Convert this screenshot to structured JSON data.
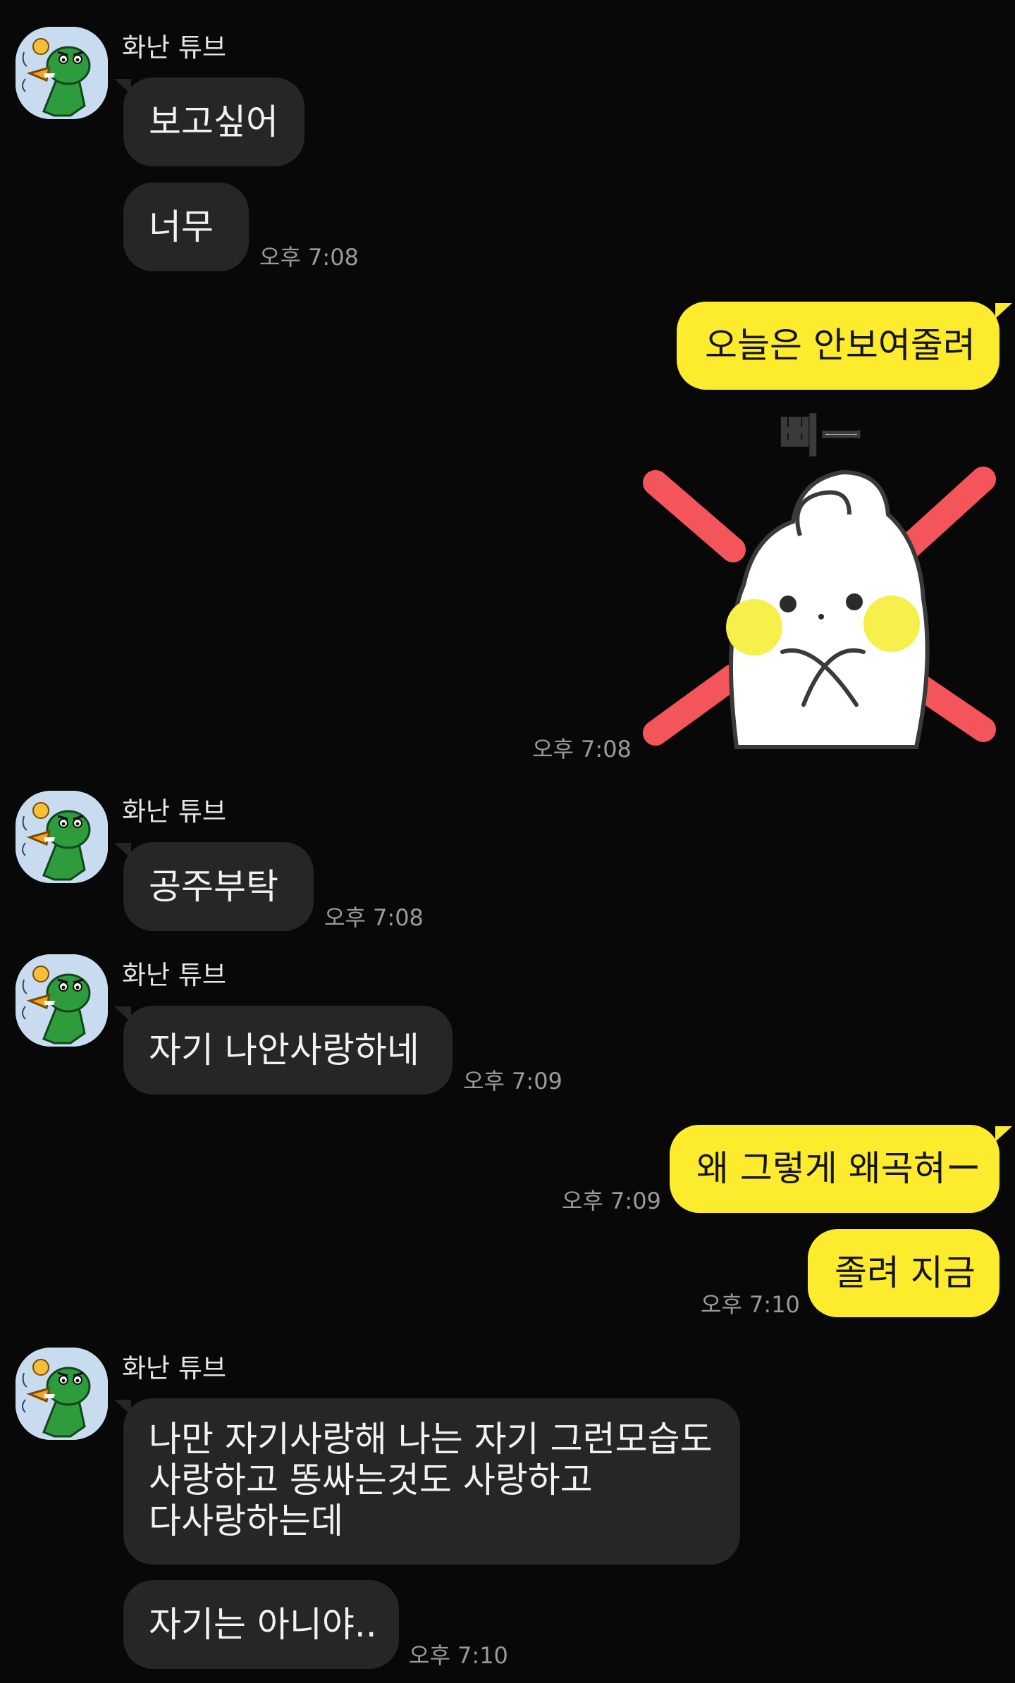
{
  "contact": {
    "name": "화난 튜브",
    "avatar_icon": "angry-tube-avatar-icon"
  },
  "colors": {
    "background": "#080808",
    "incoming_bubble": "#262626",
    "outgoing_bubble": "#fdeb2d",
    "timestamp": "#9a9a9a"
  },
  "messages": [
    {
      "text": "보고싶어"
    },
    {
      "text": "너무",
      "time": "오후 7:08"
    },
    {
      "text": "오늘은 안보여줄려"
    },
    {
      "sticker_text": "삐ー",
      "sticker_icon": "white-bunny-cross-arms-sticker",
      "time": "오후 7:08"
    },
    {
      "text": "공주부탁",
      "time": "오후 7:08"
    },
    {
      "text": "자기 나안사랑하네",
      "time": "오후 7:09"
    },
    {
      "text": "왜 그렇게 왜곡혀ー",
      "time": "오후 7:09"
    },
    {
      "text": "졸려 지금",
      "time": "오후 7:10"
    },
    {
      "lines": [
        "나만 자기사랑해 나는 자기 그런모습도",
        "사랑하고 똥싸는것도 사랑하고",
        "다사랑하는데"
      ]
    },
    {
      "text": "자기는 아니야..",
      "time": "오후 7:10"
    }
  ]
}
